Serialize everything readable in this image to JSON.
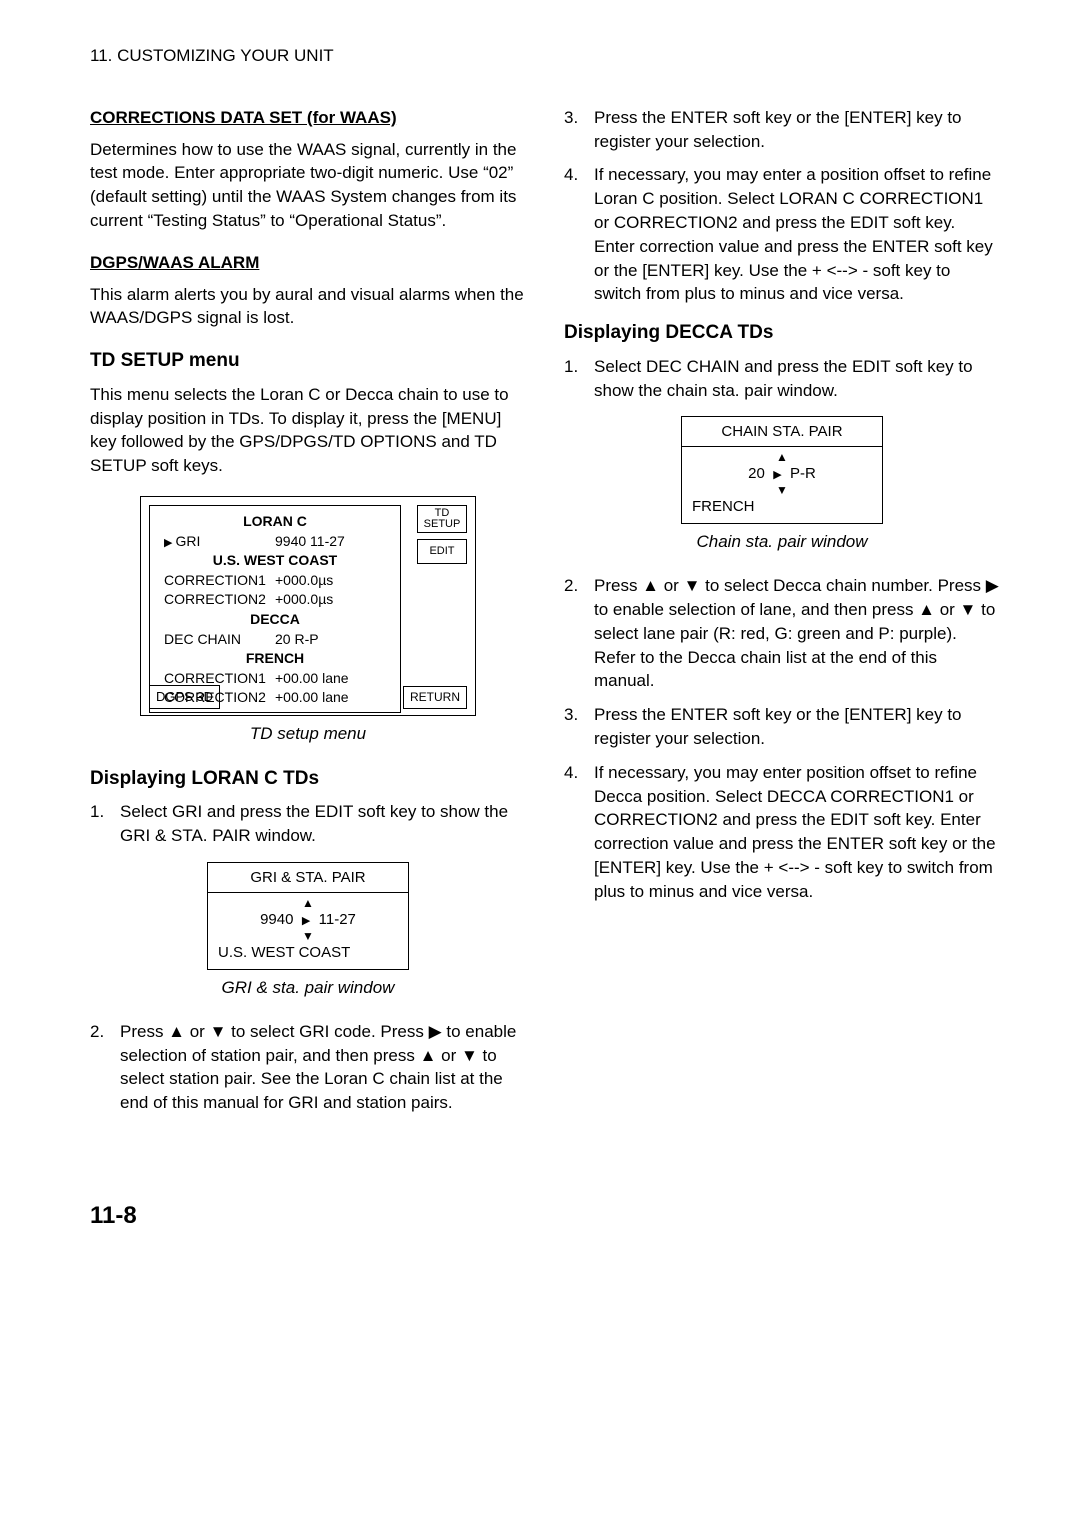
{
  "pageHeader": "11. CUSTOMIZING YOUR UNIT",
  "pageNumber": "11-8",
  "left": {
    "h1": "CORRECTIONS DATA SET (for WAAS)",
    "p1": "Determines how to use the WAAS signal, currently in the test mode. Enter appropriate two-digit numeric. Use “02” (default setting) until the WAAS System changes from its current “Testing Status” to “Operational Status”.",
    "h2": "DGPS/WAAS ALARM",
    "p2": "This alarm alerts you by aural and visual alarms when the WAAS/DGPS signal is lost.",
    "h3": "TD SETUP menu",
    "p3": "This menu selects the Loran C or Decca chain to use to display position in TDs. To display it, press the [MENU] key followed by the GPS/DPGS/TD OPTIONS and TD SETUP soft keys.",
    "tdFig": {
      "title1": "LORAN C",
      "griLabel": "GRI",
      "griVal": "9940  11-27",
      "sub1": "U.S. WEST COAST",
      "c1": "CORRECTION1",
      "c1v": "+000.0µs",
      "c2": "CORRECTION2",
      "c2v": "+000.0µs",
      "title2": "DECCA",
      "dec": "DEC CHAIN",
      "decv": "20 R-P",
      "sub2": "FRENCH",
      "d1": "CORRECTION1",
      "d1v": "+00.00 lane",
      "d2": "CORRECTION2",
      "d2v": "+00.00 lane",
      "btn1a": "TD",
      "btn1b": "SETUP",
      "btn2": "EDIT",
      "status": "DGPS 3D",
      "ret": "RETURN",
      "caption": "TD setup menu"
    },
    "h4": "Displaying LORAN C TDs",
    "ol1": {
      "i1": "Select GRI and press the EDIT soft key to show the GRI & STA. PAIR window.",
      "i2": "Press ▲ or ▼ to select GRI code. Press ▶ to enable selection of station pair, and then press ▲ or ▼ to select station pair. See the Loran C chain list at the end of this manual for GRI and station pairs."
    },
    "griWin": {
      "title": "GRI & STA. PAIR",
      "left": "9940",
      "right": "11-27",
      "bottom": "U.S. WEST COAST",
      "caption": "GRI & sta. pair window"
    }
  },
  "right": {
    "ol1": {
      "i3": "Press the ENTER soft key or the [ENTER] key to register your selection.",
      "i4": "If necessary, you may enter a position offset to refine Loran C position. Select LORAN C CORRECTION1 or CORRECTION2 and press the EDIT soft key. Enter correction value and press the ENTER soft key or the [ENTER] key. Use the + <--> - soft key to switch from plus to minus and vice versa."
    },
    "h1": "Displaying DECCA TDs",
    "ol2": {
      "i1": "Select DEC CHAIN and press the EDIT soft key to show the chain sta. pair window.",
      "i2": "Press ▲ or ▼ to select Decca chain number. Press ▶ to enable selection of lane, and then press ▲ or ▼ to select lane pair (R: red, G: green and P: purple). Refer to the Decca chain list at the end of this manual.",
      "i3": "Press the ENTER soft key or the [ENTER] key to register your selection.",
      "i4": "If necessary, you may enter position offset to refine Decca position. Select DECCA CORRECTION1 or CORRECTION2 and press the EDIT soft key. Enter correction value and press the ENTER soft key or the [ENTER] key. Use the + <--> - soft key to switch from plus to minus and vice versa."
    },
    "chainWin": {
      "title": "CHAIN STA. PAIR",
      "left": "20",
      "right": "P-R",
      "bottom": "FRENCH",
      "caption": "Chain sta. pair window"
    }
  }
}
